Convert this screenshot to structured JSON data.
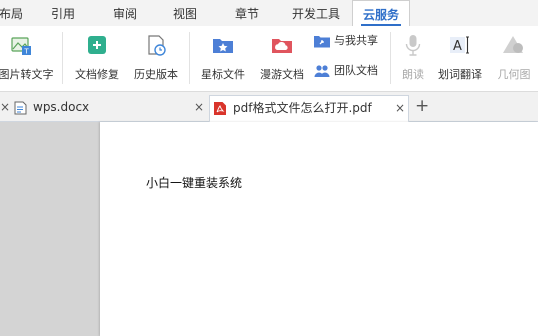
{
  "menu": {
    "tabs": [
      {
        "label": "布局"
      },
      {
        "label": "引用"
      },
      {
        "label": "审阅"
      },
      {
        "label": "视图"
      },
      {
        "label": "章节"
      },
      {
        "label": "开发工具"
      },
      {
        "label": "云服务",
        "active": true
      }
    ]
  },
  "ribbon": {
    "tools": [
      {
        "label": "图片转文字",
        "icon": "image-to-text-icon"
      },
      {
        "label": "文档修复",
        "icon": "document-repair-icon"
      },
      {
        "label": "历史版本",
        "icon": "history-version-icon"
      },
      {
        "label": "星标文件",
        "icon": "starred-folder-icon"
      },
      {
        "label": "漫游文档",
        "icon": "roaming-folder-icon"
      },
      {
        "label": "朗读",
        "icon": "microphone-icon",
        "disabled": true
      },
      {
        "label": "划词翻译",
        "icon": "translate-icon"
      },
      {
        "label": "几何图",
        "icon": "geometry-icon",
        "disabled": true
      }
    ],
    "small_tools": [
      {
        "label": "与我共享",
        "icon": "shared-with-me-icon"
      },
      {
        "label": "团队文档",
        "icon": "team-docs-icon"
      }
    ]
  },
  "doc_tabs": {
    "tabs": [
      {
        "label": "wps.docx",
        "icon": "wps-doc-icon"
      },
      {
        "label": "pdf格式文件怎么打开.pdf",
        "icon": "pdf-icon",
        "active": true
      }
    ],
    "close_glyph": "×",
    "add_glyph": "+"
  },
  "document": {
    "body_text": "小白一键重装系统"
  },
  "colors": {
    "accent": "#2f6fc9",
    "canvas": "#d4d4d4",
    "pdf_red": "#d9342b"
  }
}
